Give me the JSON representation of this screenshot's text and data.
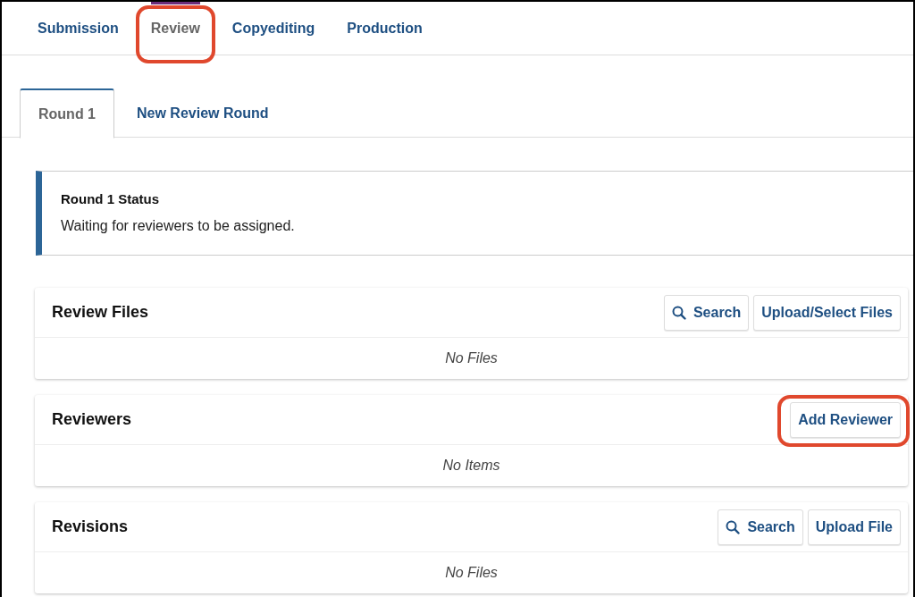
{
  "stage_tabs": [
    {
      "label": "Submission",
      "selected": false,
      "highlighted": false
    },
    {
      "label": "Review",
      "selected": true,
      "highlighted": true
    },
    {
      "label": "Copyediting",
      "selected": false,
      "highlighted": false
    },
    {
      "label": "Production",
      "selected": false,
      "highlighted": false
    }
  ],
  "round_tabs": [
    {
      "label": "Round 1",
      "selected": true
    },
    {
      "label": "New Review Round",
      "selected": false
    }
  ],
  "status": {
    "title": "Round 1 Status",
    "message": "Waiting for reviewers to be assigned."
  },
  "panels": [
    {
      "title": "Review Files",
      "buttons": [
        {
          "kind": "search",
          "label": "Search",
          "highlighted": false
        },
        {
          "kind": "plain",
          "label": "Upload/Select Files",
          "highlighted": false
        }
      ],
      "empty_text": "No Files"
    },
    {
      "title": "Reviewers",
      "buttons": [
        {
          "kind": "plain",
          "label": "Add Reviewer",
          "highlighted": true
        }
      ],
      "empty_text": "No Items"
    },
    {
      "title": "Revisions",
      "buttons": [
        {
          "kind": "search",
          "label": "Search",
          "highlighted": false
        },
        {
          "kind": "plain",
          "label": "Upload File",
          "highlighted": false
        }
      ],
      "empty_text": "No Files"
    }
  ]
}
